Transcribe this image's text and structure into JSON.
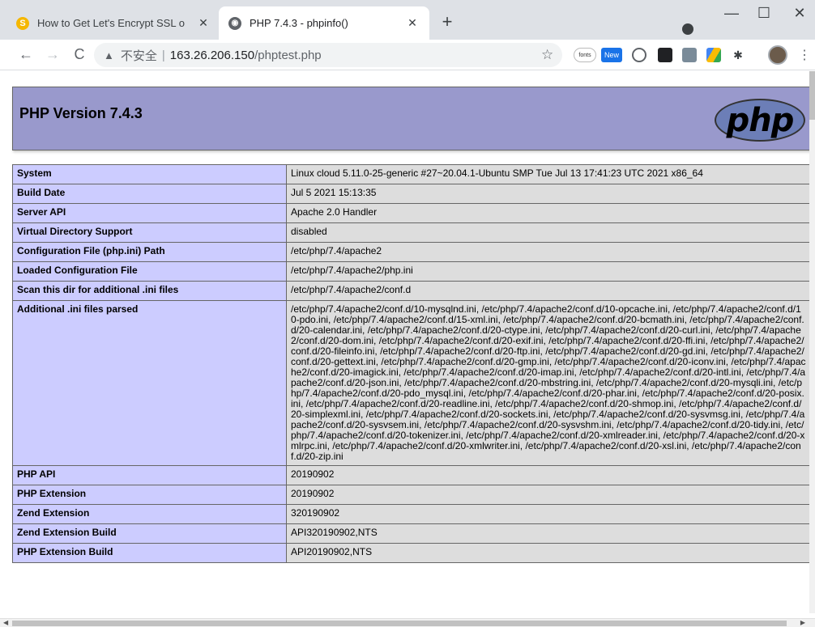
{
  "browser": {
    "tabs": [
      {
        "title": "How to Get Let's Encrypt SSL o",
        "favicon": "s-logo-icon",
        "close": "✕"
      },
      {
        "title": "PHP 7.4.3 - phpinfo()",
        "favicon": "globe-icon",
        "close": "✕"
      }
    ],
    "new_tab": "+",
    "window": {
      "minimize": "—",
      "maximize": "☐",
      "close": "✕"
    },
    "nav": {
      "back": "←",
      "forward": "→",
      "reload": "C"
    },
    "address": {
      "warning_icon": "▲",
      "security_label": "不安全",
      "separator": "|",
      "host": "163.26.206.150",
      "path": "/phptest.php"
    },
    "star": "☆",
    "extensions": {
      "fonts": "fonts",
      "new": "New",
      "puzzle": "✱"
    },
    "menu": "⋮"
  },
  "phpinfo": {
    "title": "PHP Version 7.4.3",
    "logo_text": "php",
    "rows": [
      {
        "key": "System",
        "value": "Linux cloud 5.11.0-25-generic #27~20.04.1-Ubuntu SMP Tue Jul 13 17:41:23 UTC 2021 x86_64"
      },
      {
        "key": "Build Date",
        "value": "Jul 5 2021 15:13:35"
      },
      {
        "key": "Server API",
        "value": "Apache 2.0 Handler"
      },
      {
        "key": "Virtual Directory Support",
        "value": "disabled"
      },
      {
        "key": "Configuration File (php.ini) Path",
        "value": "/etc/php/7.4/apache2"
      },
      {
        "key": "Loaded Configuration File",
        "value": "/etc/php/7.4/apache2/php.ini"
      },
      {
        "key": "Scan this dir for additional .ini files",
        "value": "/etc/php/7.4/apache2/conf.d"
      },
      {
        "key": "Additional .ini files parsed",
        "value": "/etc/php/7.4/apache2/conf.d/10-mysqlnd.ini, /etc/php/7.4/apache2/conf.d/10-opcache.ini, /etc/php/7.4/apache2/conf.d/10-pdo.ini, /etc/php/7.4/apache2/conf.d/15-xml.ini, /etc/php/7.4/apache2/conf.d/20-bcmath.ini, /etc/php/7.4/apache2/conf.d/20-calendar.ini, /etc/php/7.4/apache2/conf.d/20-ctype.ini, /etc/php/7.4/apache2/conf.d/20-curl.ini, /etc/php/7.4/apache2/conf.d/20-dom.ini, /etc/php/7.4/apache2/conf.d/20-exif.ini, /etc/php/7.4/apache2/conf.d/20-ffi.ini, /etc/php/7.4/apache2/conf.d/20-fileinfo.ini, /etc/php/7.4/apache2/conf.d/20-ftp.ini, /etc/php/7.4/apache2/conf.d/20-gd.ini, /etc/php/7.4/apache2/conf.d/20-gettext.ini, /etc/php/7.4/apache2/conf.d/20-gmp.ini, /etc/php/7.4/apache2/conf.d/20-iconv.ini, /etc/php/7.4/apache2/conf.d/20-imagick.ini, /etc/php/7.4/apache2/conf.d/20-imap.ini, /etc/php/7.4/apache2/conf.d/20-intl.ini, /etc/php/7.4/apache2/conf.d/20-json.ini, /etc/php/7.4/apache2/conf.d/20-mbstring.ini, /etc/php/7.4/apache2/conf.d/20-mysqli.ini, /etc/php/7.4/apache2/conf.d/20-pdo_mysql.ini, /etc/php/7.4/apache2/conf.d/20-phar.ini, /etc/php/7.4/apache2/conf.d/20-posix.ini, /etc/php/7.4/apache2/conf.d/20-readline.ini, /etc/php/7.4/apache2/conf.d/20-shmop.ini, /etc/php/7.4/apache2/conf.d/20-simplexml.ini, /etc/php/7.4/apache2/conf.d/20-sockets.ini, /etc/php/7.4/apache2/conf.d/20-sysvmsg.ini, /etc/php/7.4/apache2/conf.d/20-sysvsem.ini, /etc/php/7.4/apache2/conf.d/20-sysvshm.ini, /etc/php/7.4/apache2/conf.d/20-tidy.ini, /etc/php/7.4/apache2/conf.d/20-tokenizer.ini, /etc/php/7.4/apache2/conf.d/20-xmlreader.ini, /etc/php/7.4/apache2/conf.d/20-xmlrpc.ini, /etc/php/7.4/apache2/conf.d/20-xmlwriter.ini, /etc/php/7.4/apache2/conf.d/20-xsl.ini, /etc/php/7.4/apache2/conf.d/20-zip.ini"
      },
      {
        "key": "PHP API",
        "value": "20190902"
      },
      {
        "key": "PHP Extension",
        "value": "20190902"
      },
      {
        "key": "Zend Extension",
        "value": "320190902"
      },
      {
        "key": "Zend Extension Build",
        "value": "API320190902,NTS"
      },
      {
        "key": "PHP Extension Build",
        "value": "API20190902,NTS"
      }
    ]
  },
  "colors": {
    "header_bg": "#9999cc",
    "key_bg": "#ccccff",
    "value_bg": "#dddddd"
  }
}
